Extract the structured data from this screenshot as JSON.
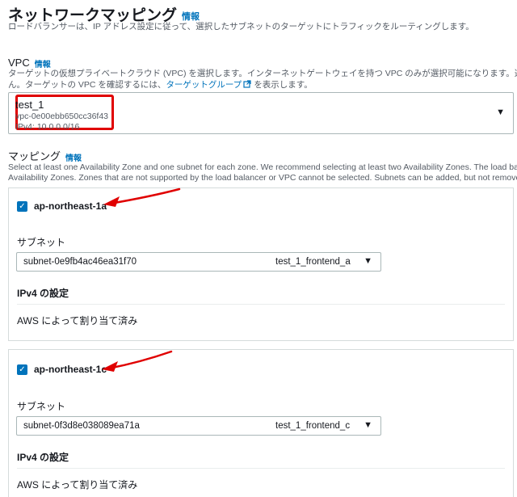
{
  "header": {
    "title": "ネットワークマッピング",
    "info": "情報",
    "description": "ロードバランサーは、IP アドレス設定に従って、選択したサブネットのターゲットにトラフィックをルーティングします。"
  },
  "vpc": {
    "label": "VPC",
    "info": "情報",
    "description_line1": "ターゲットの仮想プライベートクラウド (VPC) を選択します。インターネットゲートウェイを持つ VPC のみが選択可能になります。選択した VPC",
    "description_line2_prefix": "ん。ターゲットの VPC を確認するには、",
    "target_group_link": "ターゲットグループ",
    "description_line2_suffix": "を表示します。",
    "selected_name": "test_1",
    "selected_id": "vpc-0e00ebb650cc36f43",
    "selected_cidr": "IPv4: 10.0.0.0/16"
  },
  "mapping": {
    "label": "マッピング",
    "info": "情報",
    "description_line1": "Select at least one Availability Zone and one subnet for each zone. We recommend selecting at least two Availability Zones. The load balancer w",
    "description_line2": "Availability Zones. Zones that are not supported by the load balancer or VPC cannot be selected. Subnets can be added, but not removed, once a"
  },
  "zones": [
    {
      "name": "ap-northeast-1a",
      "checked": true,
      "subnet_label": "サブネット",
      "subnet_id": "subnet-0e9fb4ac46ea31f70",
      "subnet_name": "test_1_frontend_a",
      "ipv4_title": "IPv4 の設定",
      "ipv4_value": "AWS によって割り当て済み"
    },
    {
      "name": "ap-northeast-1c",
      "checked": true,
      "subnet_label": "サブネット",
      "subnet_id": "subnet-0f3d8e038089ea71a",
      "subnet_name": "test_1_frontend_c",
      "ipv4_title": "IPv4 の設定",
      "ipv4_value": "AWS によって割り当て済み"
    }
  ],
  "colors": {
    "accent": "#0073bb",
    "highlight": "#e00000",
    "annotation_arrow": "#e00000"
  },
  "icons": {
    "external_link": "external-link-icon",
    "caret": "caret-down-icon",
    "check": "checkmark-icon"
  }
}
